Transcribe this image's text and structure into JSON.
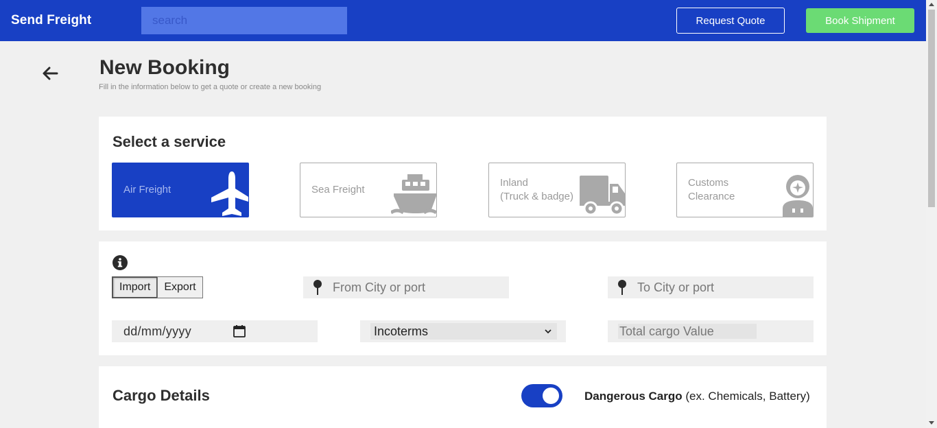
{
  "header": {
    "brand": "Send Freight",
    "search_placeholder": "search",
    "request_quote": "Request Quote",
    "book_shipment": "Book Shipment"
  },
  "page": {
    "title": "New Booking",
    "subtitle": "Fill in the information below to get a quote or create a new booking"
  },
  "services": {
    "title": "Select a service",
    "items": [
      {
        "label": "Air Freight",
        "icon": "airplane-icon",
        "active": true
      },
      {
        "label": "Sea Freight",
        "icon": "ship-icon",
        "active": false
      },
      {
        "label": "Inland\n(Truck & badge)",
        "icon": "truck-icon",
        "active": false
      },
      {
        "label": "Customs\nClearance",
        "icon": "officer-icon",
        "active": false
      }
    ]
  },
  "form": {
    "direction": [
      "Import",
      "Export"
    ],
    "from_placeholder": "From City or port",
    "to_placeholder": "To City or port",
    "date_placeholder": "dd/mm/yyyy",
    "incoterms": "Incoterms",
    "total_placeholder": "Total cargo Value"
  },
  "cargo": {
    "title": "Cargo Details",
    "dangerous_label": "Dangerous Cargo",
    "dangerous_hint": " (ex. Chemicals, Battery)"
  },
  "colors": {
    "brand_blue": "#1840c4",
    "search_bg": "#5277e6",
    "book_green": "#6bdb74"
  }
}
